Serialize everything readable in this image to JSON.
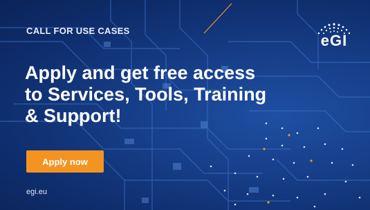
{
  "banner": {
    "kicker": "CALL FOR USE CASES",
    "headline_lines": [
      "Apply and get free access",
      "to Services, Tools, Training",
      "& Support!"
    ],
    "cta_label": "Apply now",
    "site_url": "egi.eu"
  },
  "logo": {
    "wordmark": "eGI",
    "icon": "egi-dot-arc-logo"
  },
  "colors": {
    "background": "#173f8a",
    "accent": "#f39322",
    "text": "#ffffff"
  }
}
